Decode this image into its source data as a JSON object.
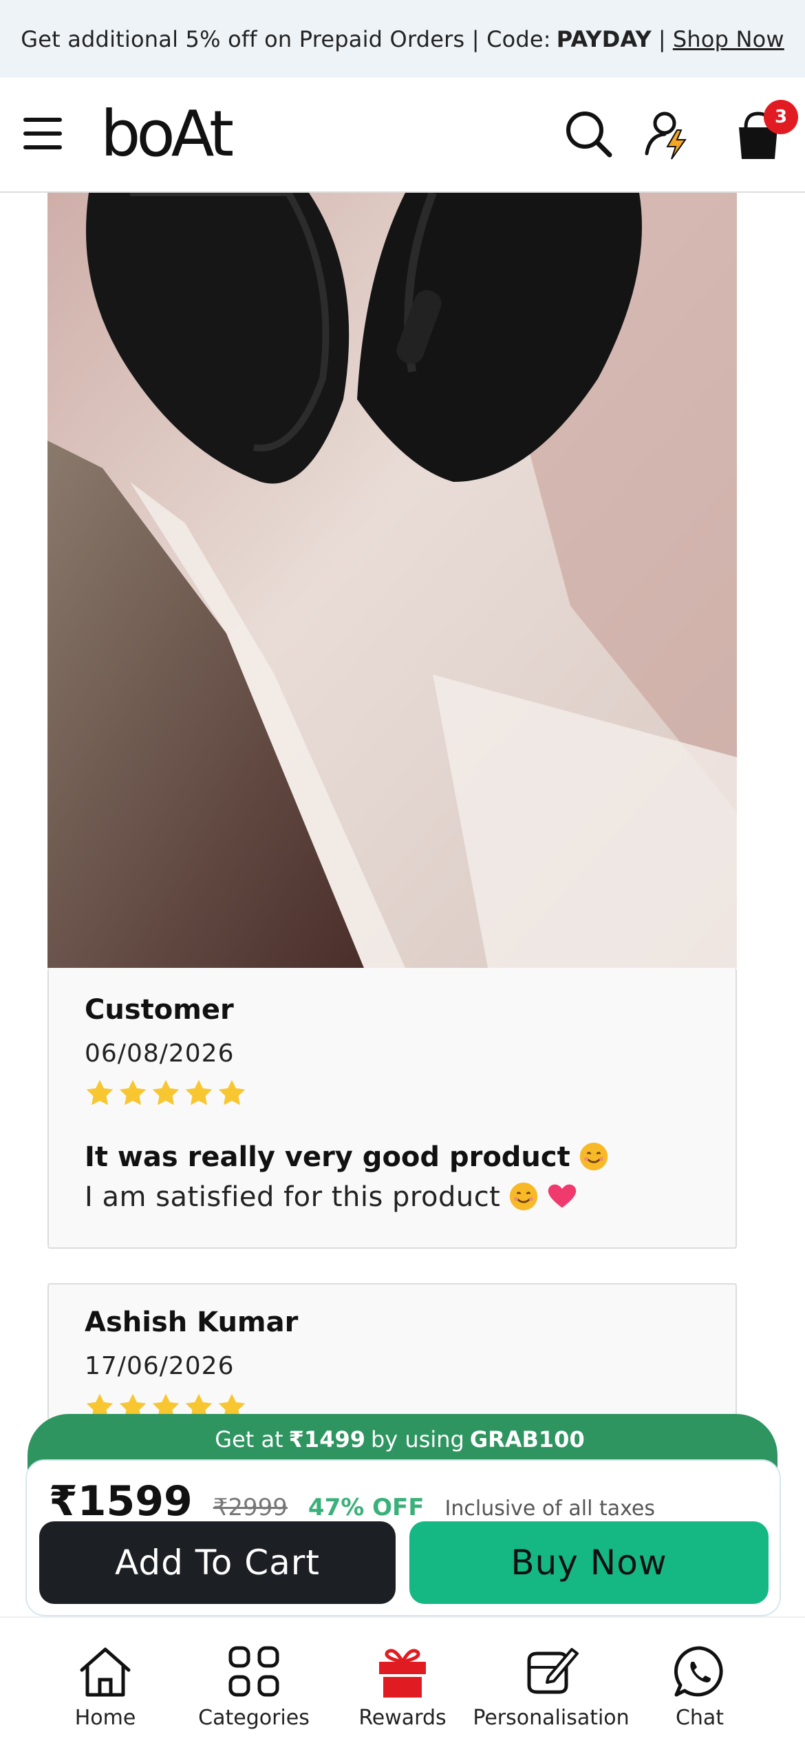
{
  "promo": {
    "text": "Get additional 5% off on Prepaid Orders | Code:",
    "code": "PAYDAY",
    "separator": "|",
    "link": "Shop Now"
  },
  "header": {
    "logo": "boAt",
    "cart_count": "3",
    "icons": [
      "hamburger-menu-icon",
      "search-icon",
      "profile-icon",
      "cart-icon"
    ]
  },
  "reviews": [
    {
      "name": "Customer",
      "date": "06/08/2026",
      "rating": 5,
      "title": "It was really very good product",
      "body": "I am satisfied for this product"
    },
    {
      "name": "Ashish Kumar",
      "date": "17/06/2026",
      "rating": 5
    }
  ],
  "offer": {
    "prefix": "Get at",
    "price": "₹1499",
    "middle": "by using",
    "code": "GRAB100"
  },
  "pricing": {
    "current": "₹1599",
    "original": "₹2999",
    "discount": "47% OFF",
    "tax_note": "Inclusive of all taxes"
  },
  "actions": {
    "add_to_cart": "Add To Cart",
    "buy_now": "Buy Now"
  },
  "bottom_nav": [
    {
      "label": "Home",
      "icon": "home-icon"
    },
    {
      "label": "Categories",
      "icon": "categories-icon"
    },
    {
      "label": "Rewards",
      "icon": "gift-icon"
    },
    {
      "label": "Personalisation",
      "icon": "personalisation-icon"
    },
    {
      "label": "Chat",
      "icon": "whatsapp-icon"
    }
  ],
  "colors": {
    "brand_red": "#e11b22",
    "offer_green": "#2e9560",
    "buy_green": "#15b883",
    "star_yellow": "#f7c631"
  }
}
